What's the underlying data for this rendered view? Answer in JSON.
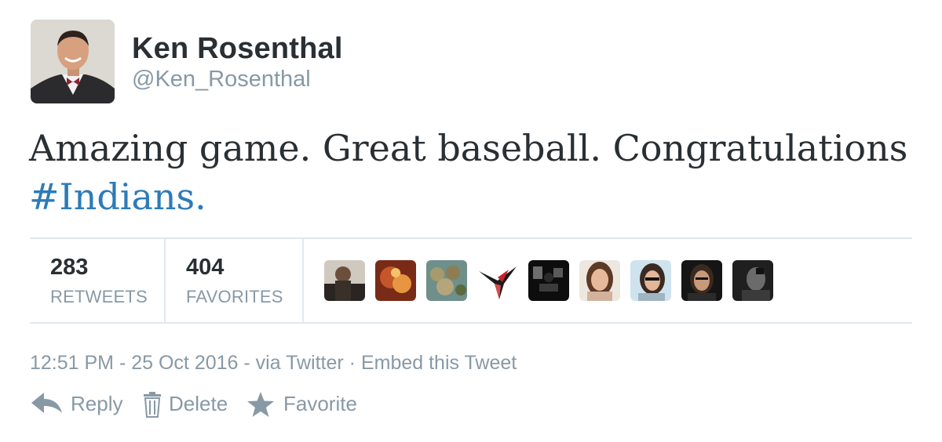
{
  "author": {
    "name": "Ken Rosenthal",
    "handle": "@Ken_Rosenthal"
  },
  "tweet": {
    "text": "Amazing game. Great baseball. Congratulations",
    "hashtag": "#Indians."
  },
  "stats": {
    "retweets_count": "283",
    "retweets_label": "RETWEETS",
    "favorites_count": "404",
    "favorites_label": "FAVORITES"
  },
  "favoriters": [
    {
      "icon": "favoriter-avatar-icon"
    },
    {
      "icon": "favoriter-avatar-icon"
    },
    {
      "icon": "favoriter-avatar-icon"
    },
    {
      "icon": "favoriter-avatar-icon"
    },
    {
      "icon": "favoriter-avatar-icon"
    },
    {
      "icon": "favoriter-avatar-icon"
    },
    {
      "icon": "favoriter-avatar-icon"
    },
    {
      "icon": "favoriter-avatar-icon"
    },
    {
      "icon": "favoriter-avatar-icon"
    }
  ],
  "meta": {
    "timestamp": "12:51 PM - 25 Oct 2016",
    "via": " - via Twitter",
    "separator": " · ",
    "embed_label": "Embed this Tweet"
  },
  "actions": {
    "reply_label": "Reply",
    "reply_icon": "reply-arrow-icon",
    "delete_label": "Delete",
    "delete_icon": "trash-icon",
    "favorite_label": "Favorite",
    "favorite_icon": "star-icon"
  },
  "colors": {
    "text": "#292f33",
    "muted": "#8899a6",
    "link": "#2b7bb9",
    "divider": "#e1e8ed"
  }
}
